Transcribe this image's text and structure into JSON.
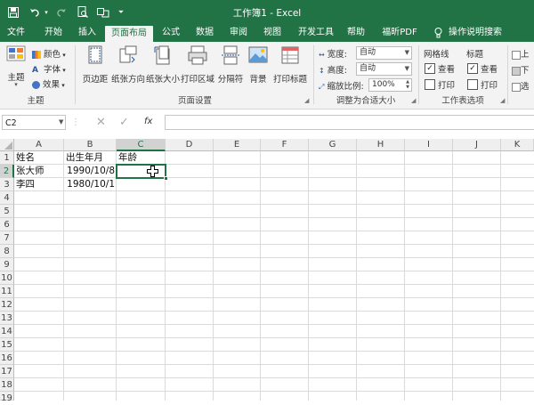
{
  "titlebar": {
    "title": "工作簿1 - Excel",
    "save_icon": "save-icon",
    "undo_icon": "undo-icon",
    "redo_icon": "redo-icon",
    "print_preview_icon": "print-preview-icon",
    "customize_icon": "customize-toolbar-icon",
    "bg_color": "#217346"
  },
  "tabs": [
    {
      "label": "文件"
    },
    {
      "label": "开始"
    },
    {
      "label": "插入"
    },
    {
      "label": "页面布局",
      "active": true
    },
    {
      "label": "公式"
    },
    {
      "label": "数据"
    },
    {
      "label": "审阅"
    },
    {
      "label": "视图"
    },
    {
      "label": "开发工具"
    },
    {
      "label": "帮助"
    },
    {
      "label": "福昕PDF"
    },
    {
      "label": "操作说明搜索"
    }
  ],
  "ribbon": {
    "themes": {
      "theme_label": "主题",
      "colors_label": "颜色",
      "fonts_label": "字体",
      "effects_label": "效果",
      "group_label": "主题"
    },
    "page_setup": {
      "margins_label": "页边距",
      "orientation_label": "纸张方向",
      "size_label": "纸张大小",
      "print_area_label": "打印区域",
      "breaks_label": "分隔符",
      "background_label": "背景",
      "print_titles_label": "打印标题",
      "group_label": "页面设置"
    },
    "scale": {
      "width_label": "宽度:",
      "width_value": "自动",
      "height_label": "高度:",
      "height_value": "自动",
      "scale_label": "缩放比例:",
      "scale_value": "100%",
      "group_label": "调整为合适大小"
    },
    "sheet_options": {
      "gridlines_label": "网格线",
      "headings_label": "标题",
      "view_label": "查看",
      "print_label": "打印",
      "gridlines_view": true,
      "gridlines_print": false,
      "headings_view": true,
      "headings_print": false,
      "group_label": "工作表选项"
    },
    "arrange": {
      "forward_label": "上",
      "backward_label": "下",
      "selection_label": "选"
    }
  },
  "formula_bar": {
    "name_box": "C2",
    "cancel_icon": "cancel-icon",
    "enter_icon": "enter-icon",
    "fx_label": "fx",
    "value": ""
  },
  "sheet": {
    "columns": [
      "A",
      "B",
      "C",
      "D",
      "E",
      "F",
      "G",
      "H",
      "I",
      "J",
      "K"
    ],
    "rows": [
      "1",
      "2",
      "3",
      "4",
      "5",
      "6",
      "7",
      "8",
      "9",
      "10",
      "11",
      "12",
      "13",
      "14",
      "15",
      "16",
      "17",
      "18",
      "19"
    ],
    "selected_cell": "C2",
    "cells": {
      "A1": "姓名",
      "B1": "出生年月",
      "C1": "年龄",
      "A2": "张大师",
      "B2": "1990/10/8",
      "A3": "李四",
      "B3": "1980/10/1"
    }
  }
}
